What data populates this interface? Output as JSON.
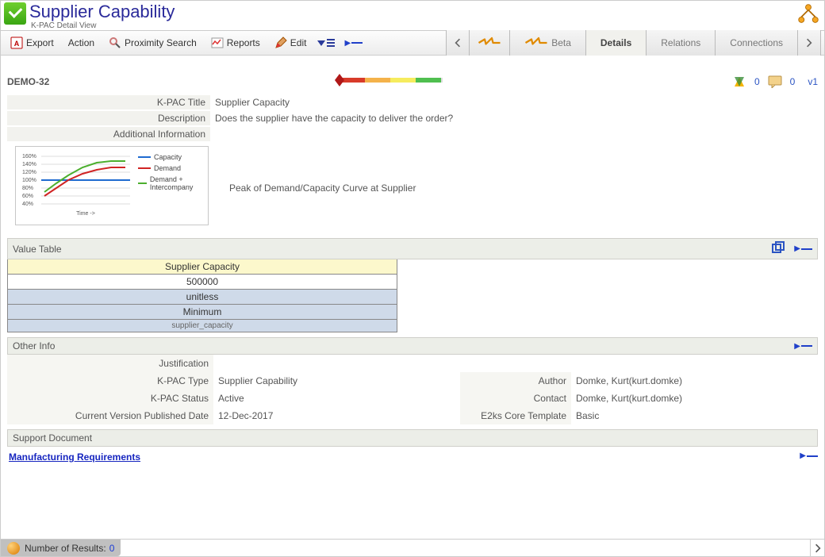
{
  "header": {
    "title": "Supplier Capability",
    "subtitle": "K-PAC Detail View"
  },
  "toolbar": {
    "export": "Export",
    "action": "Action",
    "proximity": "Proximity Search",
    "reports": "Reports",
    "edit": "Edit"
  },
  "tabs": {
    "beta": "Beta",
    "details": "Details",
    "relations": "Relations",
    "connections": "Connections"
  },
  "doc": {
    "id": "DEMO-32",
    "version": "v1",
    "rating_count_a": "0",
    "rating_count_b": "0"
  },
  "fields": {
    "title_label": "K-PAC Title",
    "title_value": "Supplier Capacity",
    "desc_label": "Description",
    "desc_value": "Does the supplier have the capacity to deliver the order?",
    "addl_label": "Additional Information",
    "chart_caption": "Peak of Demand/Capacity Curve at Supplier"
  },
  "chart_data": {
    "type": "line",
    "xlabel": "Time ->",
    "ylabel": "",
    "y_ticks": [
      "40%",
      "60%",
      "80%",
      "100%",
      "120%",
      "140%",
      "160%"
    ],
    "ylim": [
      40,
      160
    ],
    "series": [
      {
        "name": "Capacity",
        "color": "#1f6bd0",
        "values": [
          100,
          100,
          100,
          100,
          100,
          100,
          100
        ]
      },
      {
        "name": "Demand",
        "color": "#d02424",
        "values": [
          60,
          80,
          100,
          115,
          125,
          130,
          130
        ]
      },
      {
        "name": "Demand + Intercompany",
        "color": "#4caf2e",
        "values": [
          70,
          90,
          110,
          128,
          140,
          145,
          145
        ]
      }
    ]
  },
  "value_table": {
    "section": "Value Table",
    "header": "Supplier Capacity",
    "value": "500000",
    "unit": "unitless",
    "stat": "Minimum",
    "code": "supplier_capacity"
  },
  "other_info": {
    "section": "Other Info",
    "justification_label": "Justification",
    "justification_value": "",
    "type_label": "K-PAC Type",
    "type_value": "Supplier Capability",
    "author_label": "Author",
    "author_value": "Domke, Kurt(kurt.domke)",
    "status_label": "K-PAC Status",
    "status_value": "Active",
    "contact_label": "Contact",
    "contact_value": "Domke, Kurt(kurt.domke)",
    "pub_label": "Current Version Published Date",
    "pub_value": "12-Dec-2017",
    "template_label": "E2ks Core Template",
    "template_value": "Basic"
  },
  "support_doc_section": "Support Document",
  "link_section": "Manufacturing Requirements",
  "statusbar": {
    "label": "Number of Results:",
    "count": "0"
  }
}
